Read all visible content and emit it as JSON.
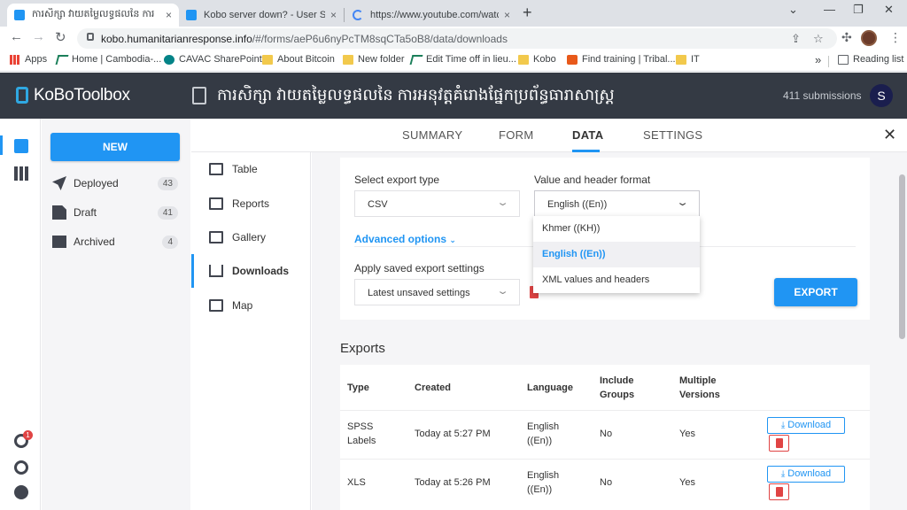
{
  "browser": {
    "tabs": [
      {
        "title": "ការសិក្សា វាយតម្លៃលទ្ធផលនៃ ការ",
        "close": "×",
        "favicon_color": "#2095f3"
      },
      {
        "title": "Kobo server down? - User Suppo",
        "close": "×",
        "favicon_color": "#2095f3"
      },
      {
        "title": "https://www.youtube.com/watch",
        "close": "×",
        "favicon_color": "#4285f4"
      }
    ],
    "new_tab": "+",
    "window_controls": [
      "⌄",
      "—",
      "❐",
      "✕"
    ],
    "nav": {
      "back": "←",
      "forward": "→",
      "reload": "↻"
    },
    "url_host": "kobo.humanitarianresponse.info",
    "url_rest": "/#/forms/aeP6u6nyPcTM8sqCTa5oB8/data/downloads",
    "omnibox_icons": {
      "share": "⇪",
      "star": "☆"
    },
    "toolbar_icons": {
      "extensions": "✣",
      "menu": "⋮"
    },
    "bookmarks": [
      {
        "label": "Apps",
        "icon": "apps-grid-icon"
      },
      {
        "label": "Home | Cambodia-...",
        "icon": "kobo-icon"
      },
      {
        "label": "CAVAC SharePoint",
        "icon": "sharepoint-icon"
      },
      {
        "label": "About Bitcoin",
        "icon": "folder-icon"
      },
      {
        "label": "New folder",
        "icon": "folder-icon"
      },
      {
        "label": "Edit Time off in lieu...",
        "icon": "kobo-icon"
      },
      {
        "label": "Kobo",
        "icon": "folder-icon"
      },
      {
        "label": "Find training | Tribal...",
        "icon": "tribal-icon"
      },
      {
        "label": "IT",
        "icon": "folder-icon"
      }
    ],
    "bookmarks_more": "»",
    "reading_list": "Reading list"
  },
  "app": {
    "logo": "KoBoToolbox",
    "form_title": "ការសិក្សា វាយតម្លៃលទ្ធផលនៃ ការអនុវត្តគំរោងផ្នែកប្រព័ន្ធធារាសាស្រ្ត",
    "submissions": "411 submissions",
    "user_initial": "S",
    "accent_color": "#2095f3",
    "header_bg": "#343a44"
  },
  "rail": {
    "notification_count": "1"
  },
  "sidebar": {
    "new_button": "NEW",
    "items": [
      {
        "label": "Deployed",
        "count": "43",
        "icon": "rocket-icon"
      },
      {
        "label": "Draft",
        "count": "41",
        "icon": "draft-icon"
      },
      {
        "label": "Archived",
        "count": "4",
        "icon": "archive-icon"
      }
    ]
  },
  "subnav": {
    "tabs": [
      "SUMMARY",
      "FORM",
      "DATA",
      "SETTINGS"
    ],
    "active": "DATA",
    "close": "✕"
  },
  "datanav": {
    "items": [
      "Table",
      "Reports",
      "Gallery",
      "Downloads",
      "Map"
    ],
    "active": "Downloads"
  },
  "export": {
    "type_label": "Select export type",
    "type_value": "CSV",
    "format_label": "Value and header format",
    "format_value": "English ((En))",
    "format_options": [
      "Khmer ((KH))",
      "English ((En))",
      "XML values and headers"
    ],
    "advanced": "Advanced options",
    "saved_label": "Apply saved export settings",
    "saved_value": "Latest unsaved settings",
    "export_button": "EXPORT"
  },
  "exports": {
    "title": "Exports",
    "headers": {
      "type": "Type",
      "created": "Created",
      "language": "Language",
      "include_groups": [
        "Include",
        "Groups"
      ],
      "multiple_versions": [
        "Multiple",
        "Versions"
      ]
    },
    "rows": [
      {
        "type": [
          "SPSS",
          "Labels"
        ],
        "created": "Today at 5:27 PM",
        "language": [
          "English",
          "((En))"
        ],
        "groups": "No",
        "versions": "Yes",
        "download": "Download"
      },
      {
        "type": [
          "XLS"
        ],
        "created": "Today at 5:26 PM",
        "language": [
          "English",
          "((En))"
        ],
        "groups": "No",
        "versions": "Yes",
        "download": "Download"
      }
    ]
  }
}
